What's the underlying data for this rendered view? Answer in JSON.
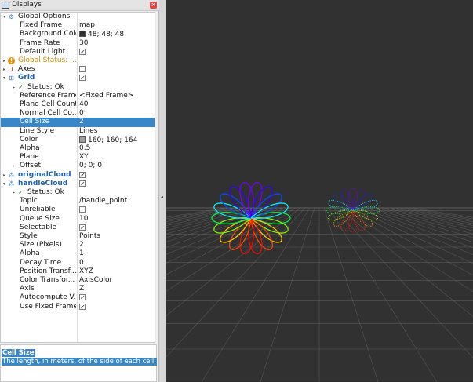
{
  "panel": {
    "title": "Displays"
  },
  "tree_rows": [
    {
      "indent": 0,
      "arrow": "▾",
      "icon": "gear-icon",
      "label": "Global Options",
      "value": ""
    },
    {
      "indent": 1,
      "label": "Fixed Frame",
      "value": "map"
    },
    {
      "indent": 1,
      "label": "Background Color",
      "value": "48; 48; 48",
      "swatch": "#303030"
    },
    {
      "indent": 1,
      "label": "Frame Rate",
      "value": "30"
    },
    {
      "indent": 1,
      "label": "Default Light",
      "check": true
    },
    {
      "indent": 0,
      "arrow": "▸",
      "icon": "warning-icon",
      "label": "Global Status: ...",
      "value": "",
      "style": "orange"
    },
    {
      "indent": 0,
      "arrow": "▸",
      "icon": "axes-icon",
      "label": "Axes",
      "check": false
    },
    {
      "indent": 0,
      "arrow": "▾",
      "icon": "grid-icon",
      "label": "Grid",
      "check": true,
      "style": "bold-blue"
    },
    {
      "indent": 1,
      "arrow": "▸",
      "icon": "checkmark-icon",
      "label": "Status: Ok",
      "value": ""
    },
    {
      "indent": 1,
      "label": "Reference Frame",
      "value": "<Fixed Frame>"
    },
    {
      "indent": 1,
      "label": "Plane Cell Count",
      "value": "40"
    },
    {
      "indent": 1,
      "label": "Normal Cell Co...",
      "value": "0"
    },
    {
      "indent": 1,
      "label": "Cell Size",
      "value": "2",
      "selected": true
    },
    {
      "indent": 1,
      "label": "Line Style",
      "value": "Lines"
    },
    {
      "indent": 1,
      "label": "Color",
      "value": "160; 160; 164",
      "swatch": "#a0a0a4"
    },
    {
      "indent": 1,
      "label": "Alpha",
      "value": "0.5"
    },
    {
      "indent": 1,
      "label": "Plane",
      "value": "XY"
    },
    {
      "indent": 1,
      "arrow": "▸",
      "label": "Offset",
      "value": "0; 0; 0"
    },
    {
      "indent": 0,
      "arrow": "▸",
      "icon": "pointcloud-icon",
      "label": "originalCloud",
      "check": true,
      "style": "bold-blue"
    },
    {
      "indent": 0,
      "arrow": "▾",
      "icon": "pointcloud-icon",
      "label": "handleCloud",
      "check": true,
      "style": "bold-blue"
    },
    {
      "indent": 1,
      "arrow": "▸",
      "icon": "checkmark-icon",
      "label": "Status: Ok",
      "value": ""
    },
    {
      "indent": 1,
      "label": "Topic",
      "value": "/handle_point"
    },
    {
      "indent": 1,
      "label": "Unreliable",
      "check": false
    },
    {
      "indent": 1,
      "label": "Queue Size",
      "value": "10"
    },
    {
      "indent": 1,
      "label": "Selectable",
      "check": true
    },
    {
      "indent": 1,
      "label": "Style",
      "value": "Points"
    },
    {
      "indent": 1,
      "label": "Size (Pixels)",
      "value": "2"
    },
    {
      "indent": 1,
      "label": "Alpha",
      "value": "1"
    },
    {
      "indent": 1,
      "label": "Decay Time",
      "value": "0"
    },
    {
      "indent": 1,
      "label": "Position Transf...",
      "value": "XYZ"
    },
    {
      "indent": 1,
      "label": "Color Transfor...",
      "value": "AxisColor"
    },
    {
      "indent": 1,
      "label": "Axis",
      "value": "Z"
    },
    {
      "indent": 1,
      "label": "Autocompute V...",
      "check": true
    },
    {
      "indent": 1,
      "label": "Use Fixed Frame",
      "check": true
    }
  ],
  "help": {
    "title": "Cell Size",
    "description": "The length, in meters, of the side of each cell."
  },
  "colors": {
    "selection": "#3a87c7",
    "viewport_background": "#313131",
    "grid_line": "#7a7a7a"
  }
}
